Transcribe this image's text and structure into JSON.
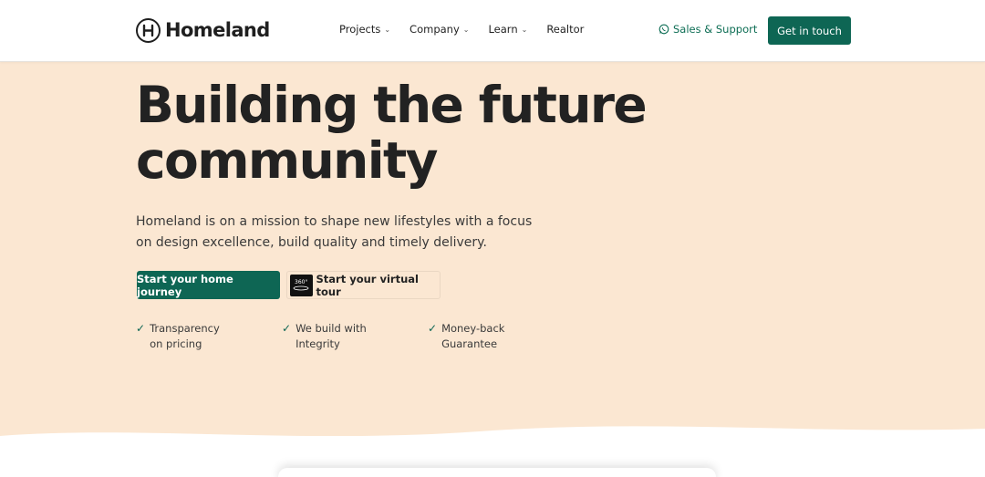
{
  "header": {
    "logo_text": "Homeland",
    "nav": [
      {
        "label": "Projects",
        "has_dropdown": true
      },
      {
        "label": "Company",
        "has_dropdown": true
      },
      {
        "label": "Learn",
        "has_dropdown": true
      },
      {
        "label": "Realtor",
        "has_dropdown": false
      }
    ],
    "support_label": "Sales & Support",
    "support_icon": "whatsapp-icon",
    "cta_label": "Get in touch"
  },
  "hero": {
    "headline": "Building the future community",
    "subtext": "Homeland is on a mission to shape new lifestyles with a focus on design excellence, build quality and timely delivery.",
    "primary_button": "Start your home journey",
    "tour_button": "Start your virtual tour",
    "tour_badge": "360°",
    "features": [
      {
        "text": "Transparency\non pricing"
      },
      {
        "text": "We build with\nIntegrity"
      },
      {
        "text": "Money-back\nGuarantee"
      }
    ],
    "check_glyph": "✓"
  },
  "colors": {
    "brand_green": "#0e6654",
    "hero_bg": "#fbe7d2",
    "text_dark": "#222222"
  }
}
